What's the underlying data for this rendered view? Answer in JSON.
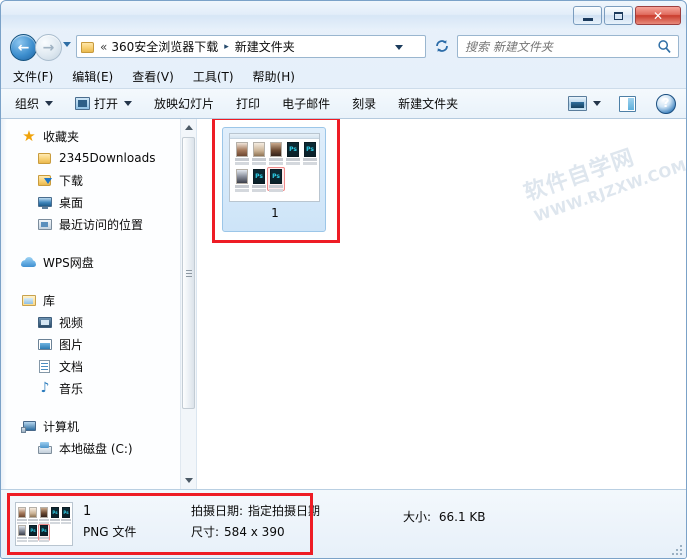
{
  "window": {
    "controls": {
      "minimize": "minimize-button",
      "maximize": "maximize-button",
      "close": "✕"
    }
  },
  "address": {
    "back_glyph": "←",
    "forward_glyph": "→",
    "separator_double": "«",
    "separator_arrow": "▸",
    "crumb_root": "360安全浏览器下载",
    "crumb_current": "新建文件夹",
    "refresh_glyph": "↻"
  },
  "search": {
    "placeholder": "搜索 新建文件夹",
    "value": ""
  },
  "menu": {
    "items": [
      {
        "label": "文件(F)"
      },
      {
        "label": "编辑(E)"
      },
      {
        "label": "查看(V)"
      },
      {
        "label": "工具(T)"
      },
      {
        "label": "帮助(H)"
      }
    ]
  },
  "toolbar": {
    "organize": "组织",
    "open": "打开",
    "slideshow": "放映幻灯片",
    "print": "打印",
    "email": "电子邮件",
    "burn": "刻录",
    "new_folder": "新建文件夹",
    "help_glyph": "?"
  },
  "sidebar": {
    "groups": [
      {
        "header": {
          "label": "收藏夹",
          "icon": "star-icon"
        },
        "items": [
          {
            "label": "2345Downloads",
            "icon": "folder-icon"
          },
          {
            "label": "下载",
            "icon": "folder-download-icon"
          },
          {
            "label": "桌面",
            "icon": "desktop-icon"
          },
          {
            "label": "最近访问的位置",
            "icon": "recent-places-icon"
          }
        ]
      },
      {
        "header": {
          "label": "WPS网盘",
          "icon": "cloud-icon"
        },
        "items": []
      },
      {
        "header": {
          "label": "库",
          "icon": "library-icon"
        },
        "items": [
          {
            "label": "视频",
            "icon": "video-icon"
          },
          {
            "label": "图片",
            "icon": "picture-icon"
          },
          {
            "label": "文档",
            "icon": "document-icon"
          },
          {
            "label": "音乐",
            "icon": "music-icon"
          }
        ]
      },
      {
        "header": {
          "label": "计算机",
          "icon": "computer-icon"
        },
        "items": [
          {
            "label": "本地磁盘 (C:)",
            "icon": "hard-drive-icon"
          }
        ]
      }
    ]
  },
  "file_list": {
    "selected_file": {
      "name": "1",
      "thumbnail_alt": "screenshot-of-folder-with-ps-files"
    }
  },
  "watermark": {
    "line1": "软件自学网",
    "line2": "WWW.RJZXW.COM"
  },
  "details": {
    "name": "1",
    "date_label": "拍摄日期:",
    "date_value": "指定拍摄日期",
    "type": "PNG 文件",
    "dimensions_label": "尺寸:",
    "dimensions_value": "584 x 390",
    "size_label": "大小:",
    "size_value": "66.1 KB"
  },
  "colors": {
    "highlight_red": "#EE1C25",
    "window_border": "#7BA2C8",
    "selection_blue": "#CDE4F8"
  }
}
